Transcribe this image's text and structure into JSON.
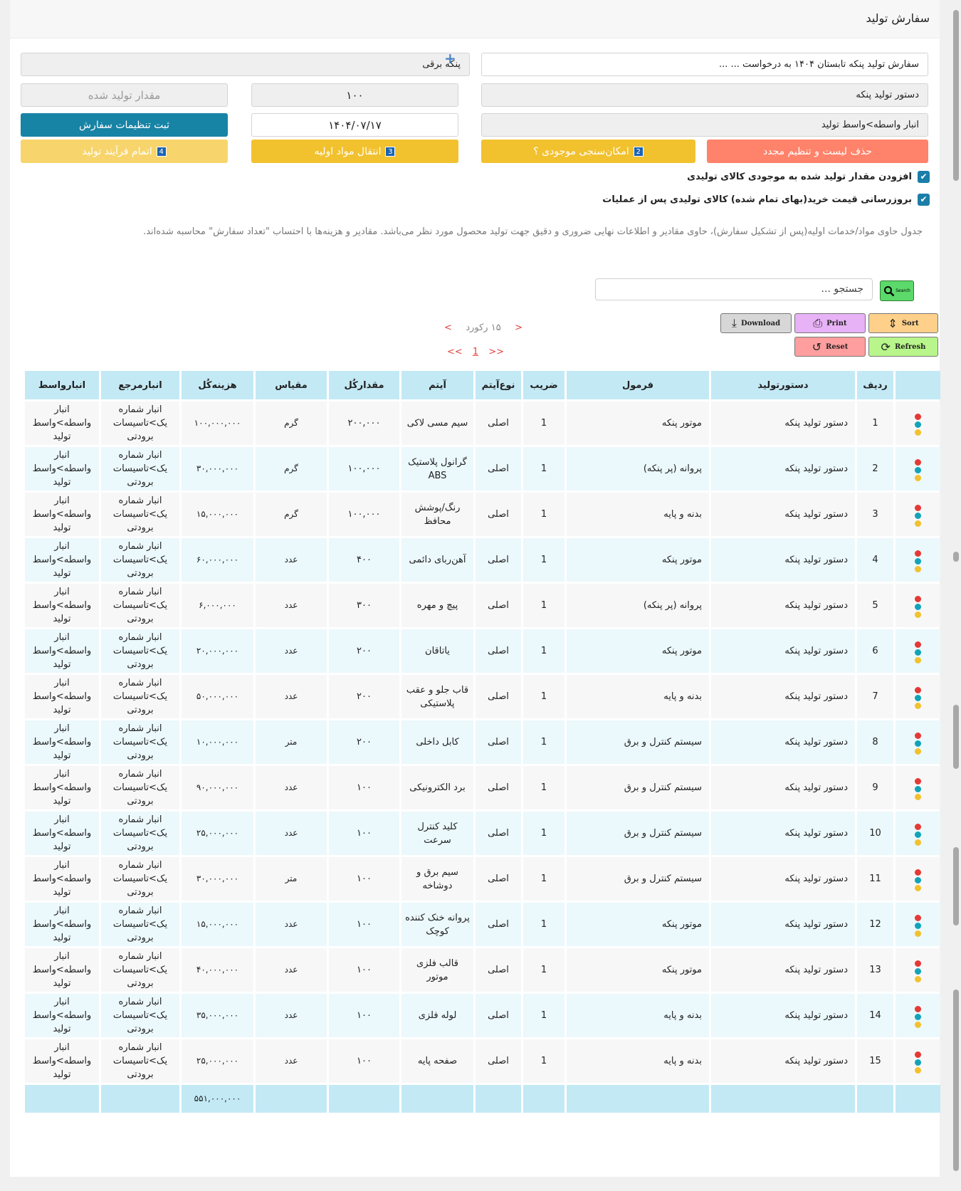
{
  "header": {
    "title": "سفارش تولید"
  },
  "form": {
    "order_title": "سفارش تولید پنکه تابستان ۱۴۰۴ به درخواست ...  ...",
    "product": "پنکه برقی",
    "formula": "دستور تولید پنکه",
    "quantity": "۱۰۰",
    "produced_placeholder": "مقدار تولید شده",
    "warehouse": "انبار واسطه>واسط تولید",
    "date": "۱۴۰۴/۰۷/۱۷",
    "save_settings": "ثبت تنظیمات سفارش"
  },
  "actions": {
    "delete_reset": "حذف لیست و تنظیم مجدد",
    "check_stock": "امکان‌سنجی موجودی ؟",
    "check_stock_num": "2",
    "transfer": "انتقال مواد اولیه",
    "transfer_num": "3",
    "finish": "اتمام فرآیند تولید",
    "finish_num": "4"
  },
  "options": {
    "add_stock": "افزودن مقدار تولید شده به موجودی کالای تولیدی",
    "update_price": "بروزرسانی قیمت خرید(بهای تمام شده) کالای تولیدی پس از عملیات"
  },
  "note": "جدول حاوی مواد/خدمات اولیه(پس از تشکیل سفارش)، حاوی مقادیر و اطلاعات نهایی ضروری و دقیق جهت تولید محصول مورد نظر می‌باشد. مقادیر و هزینه‌ها با احتساب \"تعداد سفارش\" محاسبه شده‌اند.",
  "search": {
    "value": "جستجو ...",
    "button": "Search"
  },
  "toolbar": {
    "sort": "Sort",
    "print": "Print",
    "download": "Download",
    "refresh": "Refresh",
    "reset": "Reset"
  },
  "pager": {
    "records": "۱۵ رکورد",
    "page": "1",
    "prev": "<",
    "next": ">",
    "first": "<<",
    "last": ">>"
  },
  "colors": {
    "red": "#ff826a",
    "yellow": "#f2c12e",
    "light_yellow": "#f7d56c",
    "teal": "#1783a5",
    "header": "#c3e9f5"
  },
  "table": {
    "headers": [
      "",
      "ردیف",
      "دستورتولید",
      "فرمول",
      "ضریب",
      "نوع‌آیتم",
      "آیتم",
      "مقدارکُل",
      "مقیاس",
      "هزینه‌کُل",
      "انبارمرجع",
      "انبارواسط"
    ],
    "rows": [
      [
        "1",
        "دستور تولید پنکه",
        "موتور پنکه",
        "1",
        "اصلی",
        "سیم مسی لاکی",
        "۲۰۰,۰۰۰",
        "گرم",
        "۱۰۰,۰۰۰,۰۰۰",
        "انبار شماره یک>تاسیسات برودتی",
        "انبار واسطه>واسط تولید"
      ],
      [
        "2",
        "دستور تولید پنکه",
        "پروانه (پر پنکه)",
        "1",
        "اصلی",
        "گرانول پلاستیک ABS",
        "۱۰۰,۰۰۰",
        "گرم",
        "۳۰,۰۰۰,۰۰۰",
        "انبار شماره یک>تاسیسات برودتی",
        "انبار واسطه>واسط تولید"
      ],
      [
        "3",
        "دستور تولید پنکه",
        "بدنه و پایه",
        "1",
        "اصلی",
        "رنگ/پوشش محافظ",
        "۱۰۰,۰۰۰",
        "گرم",
        "۱۵,۰۰۰,۰۰۰",
        "انبار شماره یک>تاسیسات برودتی",
        "انبار واسطه>واسط تولید"
      ],
      [
        "4",
        "دستور تولید پنکه",
        "موتور پنکه",
        "1",
        "اصلی",
        "آهن‌ربای دائمی",
        "۴۰۰",
        "عدد",
        "۶۰,۰۰۰,۰۰۰",
        "انبار شماره یک>تاسیسات برودتی",
        "انبار واسطه>واسط تولید"
      ],
      [
        "5",
        "دستور تولید پنکه",
        "پروانه (پر پنکه)",
        "1",
        "اصلی",
        "پیچ و مهره",
        "۳۰۰",
        "عدد",
        "۶,۰۰۰,۰۰۰",
        "انبار شماره یک>تاسیسات برودتی",
        "انبار واسطه>واسط تولید"
      ],
      [
        "6",
        "دستور تولید پنکه",
        "موتور پنکه",
        "1",
        "اصلی",
        "یاتاقان",
        "۲۰۰",
        "عدد",
        "۲۰,۰۰۰,۰۰۰",
        "انبار شماره یک>تاسیسات برودتی",
        "انبار واسطه>واسط تولید"
      ],
      [
        "7",
        "دستور تولید پنکه",
        "بدنه و پایه",
        "1",
        "اصلی",
        "قاب جلو و عقب پلاستیکی",
        "۲۰۰",
        "عدد",
        "۵۰,۰۰۰,۰۰۰",
        "انبار شماره یک>تاسیسات برودتی",
        "انبار واسطه>واسط تولید"
      ],
      [
        "8",
        "دستور تولید پنکه",
        "سیستم کنترل و برق",
        "1",
        "اصلی",
        "کابل داخلی",
        "۲۰۰",
        "متر",
        "۱۰,۰۰۰,۰۰۰",
        "انبار شماره یک>تاسیسات برودتی",
        "انبار واسطه>واسط تولید"
      ],
      [
        "9",
        "دستور تولید پنکه",
        "سیستم کنترل و برق",
        "1",
        "اصلی",
        "برد الکترونیکی",
        "۱۰۰",
        "عدد",
        "۹۰,۰۰۰,۰۰۰",
        "انبار شماره یک>تاسیسات برودتی",
        "انبار واسطه>واسط تولید"
      ],
      [
        "10",
        "دستور تولید پنکه",
        "سیستم کنترل و برق",
        "1",
        "اصلی",
        "کلید کنترل سرعت",
        "۱۰۰",
        "عدد",
        "۲۵,۰۰۰,۰۰۰",
        "انبار شماره یک>تاسیسات برودتی",
        "انبار واسطه>واسط تولید"
      ],
      [
        "11",
        "دستور تولید پنکه",
        "سیستم کنترل و برق",
        "1",
        "اصلی",
        "سیم برق و دوشاخه",
        "۱۰۰",
        "متر",
        "۳۰,۰۰۰,۰۰۰",
        "انبار شماره یک>تاسیسات برودتی",
        "انبار واسطه>واسط تولید"
      ],
      [
        "12",
        "دستور تولید پنکه",
        "موتور پنکه",
        "1",
        "اصلی",
        "پروانه خنک کننده کوچک",
        "۱۰۰",
        "عدد",
        "۱۵,۰۰۰,۰۰۰",
        "انبار شماره یک>تاسیسات برودتی",
        "انبار واسطه>واسط تولید"
      ],
      [
        "13",
        "دستور تولید پنکه",
        "موتور پنکه",
        "1",
        "اصلی",
        "قالب فلزی موتور",
        "۱۰۰",
        "عدد",
        "۴۰,۰۰۰,۰۰۰",
        "انبار شماره یک>تاسیسات برودتی",
        "انبار واسطه>واسط تولید"
      ],
      [
        "14",
        "دستور تولید پنکه",
        "بدنه و پایه",
        "1",
        "اصلی",
        "لوله فلزی",
        "۱۰۰",
        "عدد",
        "۳۵,۰۰۰,۰۰۰",
        "انبار شماره یک>تاسیسات برودتی",
        "انبار واسطه>واسط تولید"
      ],
      [
        "15",
        "دستور تولید پنکه",
        "بدنه و پایه",
        "1",
        "اصلی",
        "صفحه پایه",
        "۱۰۰",
        "عدد",
        "۲۵,۰۰۰,۰۰۰",
        "انبار شماره یک>تاسیسات برودتی",
        "انبار واسطه>واسط تولید"
      ]
    ],
    "total_cost": "۵۵۱,۰۰۰,۰۰۰"
  }
}
